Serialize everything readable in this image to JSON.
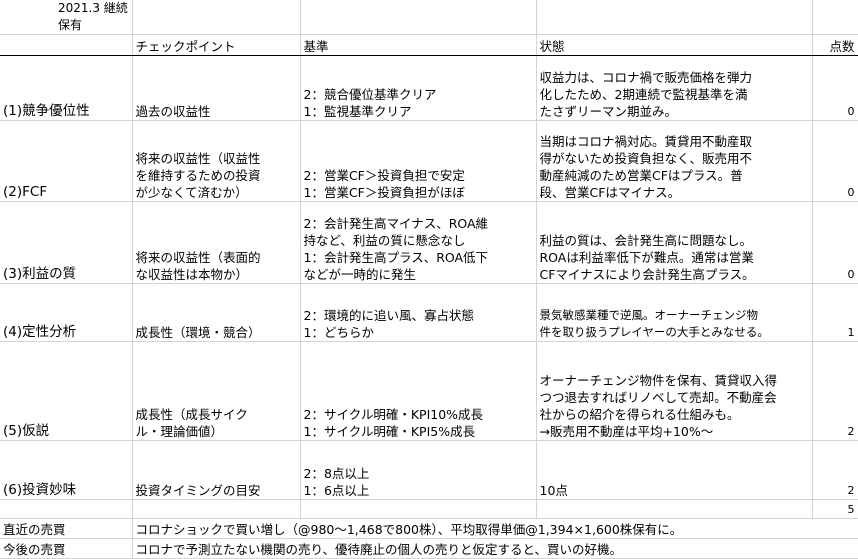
{
  "sheet": {
    "title": "2021.3 継続保有",
    "headers": {
      "check_point": "チェックポイント",
      "criteria": "基準",
      "status": "状態",
      "score": "点数"
    },
    "rows": [
      {
        "label": "(1)競争優位性",
        "check": "過去の収益性",
        "criteria": "2：競合優位基準クリア\n1：監視基準クリア",
        "status": "収益力は、コロナ禍で販売価格を弾力\n化したため、2期連続で監視基準を満\nたさずリーマン期並み。",
        "score": "0"
      },
      {
        "label": "(2)FCF",
        "check": "将来の収益性（収益性\nを維持するための投資\nが少なくて済むか）",
        "criteria": "2：営業CF＞投資負担で安定\n1：営業CF＞投資負担がほぼ",
        "status": "当期はコロナ禍対応。賃貸用不動産取\n得がないため投資負担なく、販売用不\n動産純減のため営業CFはプラス。普\n段、営業CFはマイナス。",
        "score": "0"
      },
      {
        "label": "(3)利益の質",
        "check": "将来の収益性（表面的\nな収益性は本物か）",
        "criteria": "2：会計発生高マイナス、ROA維\n持など、利益の質に懸念なし\n1：会計発生高プラス、ROA低下\nなどが一時的に発生",
        "status": "利益の質は、会計発生高に問題なし。\nROAは利益率低下が難点。通常は営業\nCFマイナスにより会計発生高プラス。",
        "score": "0"
      },
      {
        "label": "(4)定性分析",
        "check": "成長性（環境・競合）",
        "criteria": "2：環境的に追い風、寡占状態\n1：どちらか",
        "status": "景気敏感業種で逆風。オーナーチェンジ物\n件を取り扱うプレイヤーの大手とみなせる。",
        "score": "1"
      },
      {
        "label": "(5)仮説",
        "check": "成長性（成長サイク\nル・理論価値）",
        "criteria": "2：サイクル明確・KPI10%成長\n1：サイクル明確・KPI5%成長",
        "status": "オーナーチェンジ物件を保有、賃貸収入得\nつつ退去すればリノベして売却。不動産会\n社からの紹介を得られる仕組みも。\n→販売用不動産は平均+10%〜",
        "score": "2"
      },
      {
        "label": "(6)投資妙味",
        "check": "投資タイミングの目安",
        "criteria": "2：8点以上\n1：6点以上",
        "status": "10点",
        "score": "2"
      }
    ],
    "total": "5",
    "recent_trade_label": "直近の売買",
    "recent_trade_text": "コロナショックで買い増し（@980〜1,468で800株）、平均取得単価@1,394×1,600株保有に。",
    "future_trade_label": "今後の売買",
    "future_trade_text": "コロナで予測立たない機関の売り、優待廃止の個人の売りと仮定すると、買いの好機。"
  }
}
